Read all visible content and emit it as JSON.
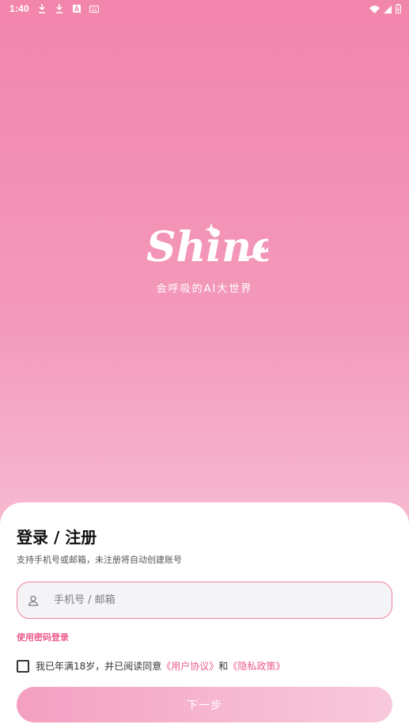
{
  "status_bar": {
    "time": "1:40",
    "left_icons": [
      "download-icon",
      "download-icon",
      "a-icon",
      "keyboard-icon"
    ],
    "right_icons": [
      "wifi-icon",
      "signal-icon",
      "battery-icon"
    ]
  },
  "brand": {
    "logo_text": "Shine",
    "tagline": "会呼吸的AI大世界"
  },
  "login": {
    "title": "登录 / 注册",
    "subtitle": "支持手机号或邮箱，未注册将自动创建账号",
    "input_placeholder": "手机号 / 邮箱",
    "input_value": "",
    "password_login_link": "使用密码登录",
    "agreement_prefix": "我已年满18岁，并已阅读同意",
    "user_agreement": "《用户协议》",
    "agreement_and": "和",
    "privacy_policy": "《隐私政策》",
    "agreement_checked": false,
    "next_button": "下一步"
  },
  "colors": {
    "accent": "#ec5b8f",
    "bg_top": "#f285ac",
    "bg_bottom": "#f9cadb"
  }
}
